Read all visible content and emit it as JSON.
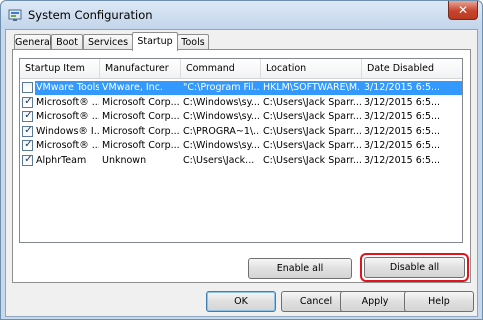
{
  "window": {
    "title": "System Configuration",
    "close_glyph": "✕"
  },
  "tabs": [
    "General",
    "Boot",
    "Services",
    "Startup",
    "Tools"
  ],
  "active_tab": "Startup",
  "list": {
    "columns": [
      "Startup Item",
      "Manufacturer",
      "Command",
      "Location",
      "Date Disabled"
    ],
    "rows": [
      {
        "checked": false,
        "selected": true,
        "cells": [
          "VMware Tools",
          "VMware, Inc.",
          "\"C:\\Program Fil...",
          "HKLM\\SOFTWARE\\M...",
          "3/12/2015 6:5..."
        ]
      },
      {
        "checked": true,
        "selected": false,
        "cells": [
          "Microsoft® ...",
          "Microsoft Corp...",
          "C:\\Windows\\sy...",
          "C:\\Users\\Jack Sparr...",
          "3/12/2015 6:5..."
        ]
      },
      {
        "checked": true,
        "selected": false,
        "cells": [
          "Microsoft® ...",
          "Microsoft Corp...",
          "C:\\Windows\\sy...",
          "C:\\Users\\Jack Sparr...",
          "3/12/2015 6:5..."
        ]
      },
      {
        "checked": true,
        "selected": false,
        "cells": [
          "Windows® I...",
          "Microsoft Corp...",
          "C:\\PROGRA~1\\...",
          "C:\\Users\\Jack Sparr...",
          "3/12/2015 6:5..."
        ]
      },
      {
        "checked": true,
        "selected": false,
        "cells": [
          "Microsoft® ...",
          "Microsoft Corp...",
          "C:\\Windows\\sy...",
          "C:\\Users\\Jack Sparr...",
          "3/12/2015 6:5..."
        ]
      },
      {
        "checked": true,
        "selected": false,
        "cells": [
          "AlphrTeam",
          "Unknown",
          "C:\\Users\\Jack...",
          "C:\\Users\\Jack Sparr...",
          "3/12/2015 6:5..."
        ]
      }
    ]
  },
  "buttons": {
    "enable_all": "Enable all",
    "disable_all": "Disable all",
    "ok": "OK",
    "cancel": "Cancel",
    "apply": "Apply",
    "help": "Help"
  },
  "colors": {
    "selection": "#3399ff",
    "highlight_ring": "#e0141e",
    "close_button": "#c8442c"
  },
  "icons": {
    "app": "system-configuration-icon",
    "check": "checkmark-icon"
  }
}
